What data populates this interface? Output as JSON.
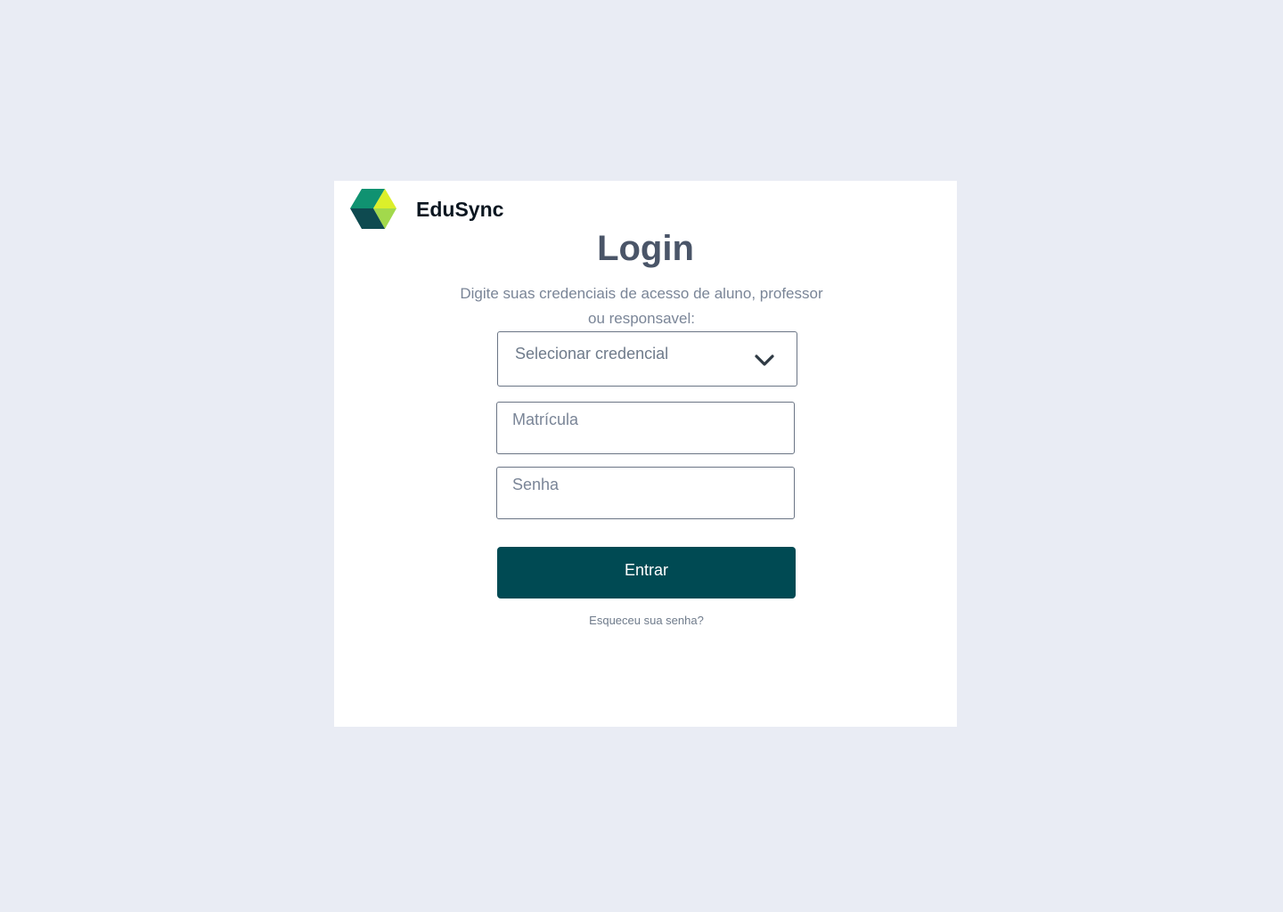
{
  "brand": {
    "name": "EduSync",
    "logo_icon": "edusync-logo-icon",
    "logo_colors": [
      "#0f8f6e",
      "#dcef2a",
      "#9fd84a",
      "#0f4a4f"
    ]
  },
  "login": {
    "title": "Login",
    "subtitle": "Digite suas credenciais de acesso de aluno, professor ou responsavel:",
    "credential_select": {
      "value": "Selecionar credencial",
      "icon": "chevron-down-icon"
    },
    "matricula_field": {
      "placeholder": "Matrícula",
      "value": ""
    },
    "senha_field": {
      "placeholder": "Senha",
      "value": ""
    },
    "submit_label": "Entrar",
    "forgot_label": "Esqueceu sua senha?"
  },
  "colors": {
    "background": "#e9ecf4",
    "primary_button": "#004a53",
    "title_text": "#4a5568",
    "muted_text": "#7a8597"
  }
}
